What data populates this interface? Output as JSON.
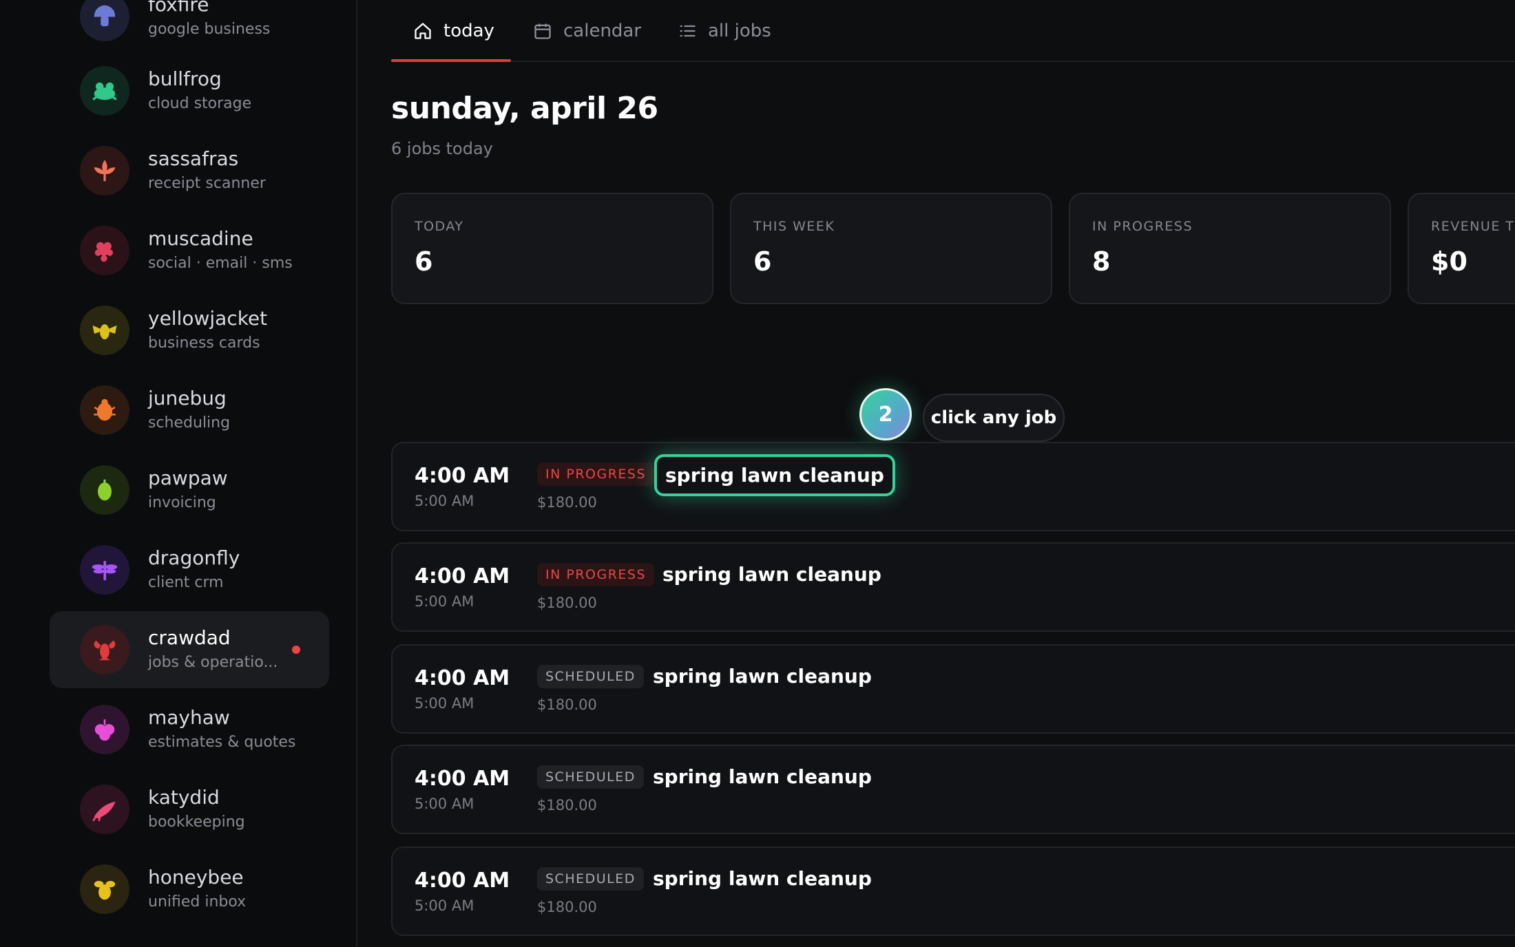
{
  "sidebar": {
    "apps": [
      {
        "name": "foxfire",
        "subtitle": "google business",
        "icon": "mushroom-icon",
        "color": "#6b7bd6",
        "bg": "#1d2033"
      },
      {
        "name": "bullfrog",
        "subtitle": "cloud storage",
        "icon": "frog-icon",
        "color": "#2fc98b",
        "bg": "#10271f"
      },
      {
        "name": "sassafras",
        "subtitle": "receipt scanner",
        "icon": "leaf-icon",
        "color": "#f0735a",
        "bg": "#2d1716"
      },
      {
        "name": "muscadine",
        "subtitle": "social · email · sms",
        "icon": "grapes-icon",
        "color": "#e0415a",
        "bg": "#2b1218"
      },
      {
        "name": "yellowjacket",
        "subtitle": "business cards",
        "icon": "wasp-icon",
        "color": "#d8c21e",
        "bg": "#2a2710"
      },
      {
        "name": "junebug",
        "subtitle": "scheduling",
        "icon": "beetle-icon",
        "color": "#f0782a",
        "bg": "#2d1a10"
      },
      {
        "name": "pawpaw",
        "subtitle": "invoicing",
        "icon": "fruit-icon",
        "color": "#8bd12a",
        "bg": "#1c2810"
      },
      {
        "name": "dragonfly",
        "subtitle": "client crm",
        "icon": "dragonfly-icon",
        "color": "#a855f7",
        "bg": "#22153a"
      },
      {
        "name": "crawdad",
        "subtitle": "jobs & operatio...",
        "icon": "crayfish-icon",
        "color": "#e23b3b",
        "bg": "#3a1a1c",
        "active": true
      },
      {
        "name": "mayhaw",
        "subtitle": "estimates & quotes",
        "icon": "berries-icon",
        "color": "#e94fd6",
        "bg": "#2f1430"
      },
      {
        "name": "katydid",
        "subtitle": "bookkeeping",
        "icon": "katydid-icon",
        "color": "#ec4a7a",
        "bg": "#2d1320"
      },
      {
        "name": "honeybee",
        "subtitle": "unified inbox",
        "icon": "bee-icon",
        "color": "#e6c21a",
        "bg": "#2a2410"
      }
    ]
  },
  "tabs": [
    {
      "label": "today",
      "icon": "home-icon",
      "active": true
    },
    {
      "label": "calendar",
      "icon": "calendar-icon",
      "active": false
    },
    {
      "label": "all jobs",
      "icon": "list-icon",
      "active": false
    }
  ],
  "header": {
    "title": "sunday, april 26",
    "subtitle": "6 jobs today"
  },
  "stats": [
    {
      "label": "TODAY",
      "value": "6"
    },
    {
      "label": "THIS WEEK",
      "value": "6"
    },
    {
      "label": "IN PROGRESS",
      "value": "8"
    },
    {
      "label": "REVENUE TI",
      "value": "$0"
    }
  ],
  "tutorial": {
    "step": "2",
    "hint": "click any job"
  },
  "jobs": [
    {
      "start": "4:00 AM",
      "end": "5:00 AM",
      "status": "IN PROGRESS",
      "status_key": "in-progress",
      "title": "spring lawn cleanup",
      "price": "$180.00",
      "highlight": true
    },
    {
      "start": "4:00 AM",
      "end": "5:00 AM",
      "status": "IN PROGRESS",
      "status_key": "in-progress",
      "title": "spring lawn cleanup",
      "price": "$180.00",
      "highlight": false
    },
    {
      "start": "4:00 AM",
      "end": "5:00 AM",
      "status": "SCHEDULED",
      "status_key": "scheduled",
      "title": "spring lawn cleanup",
      "price": "$180.00",
      "highlight": false
    },
    {
      "start": "4:00 AM",
      "end": "5:00 AM",
      "status": "SCHEDULED",
      "status_key": "scheduled",
      "title": "spring lawn cleanup",
      "price": "$180.00",
      "highlight": false
    },
    {
      "start": "4:00 AM",
      "end": "5:00 AM",
      "status": "SCHEDULED",
      "status_key": "scheduled",
      "title": "spring lawn cleanup",
      "price": "$180.00",
      "highlight": false
    }
  ],
  "colors": {
    "accent_red": "#e23b3b",
    "highlight_green": "#34d39a"
  }
}
